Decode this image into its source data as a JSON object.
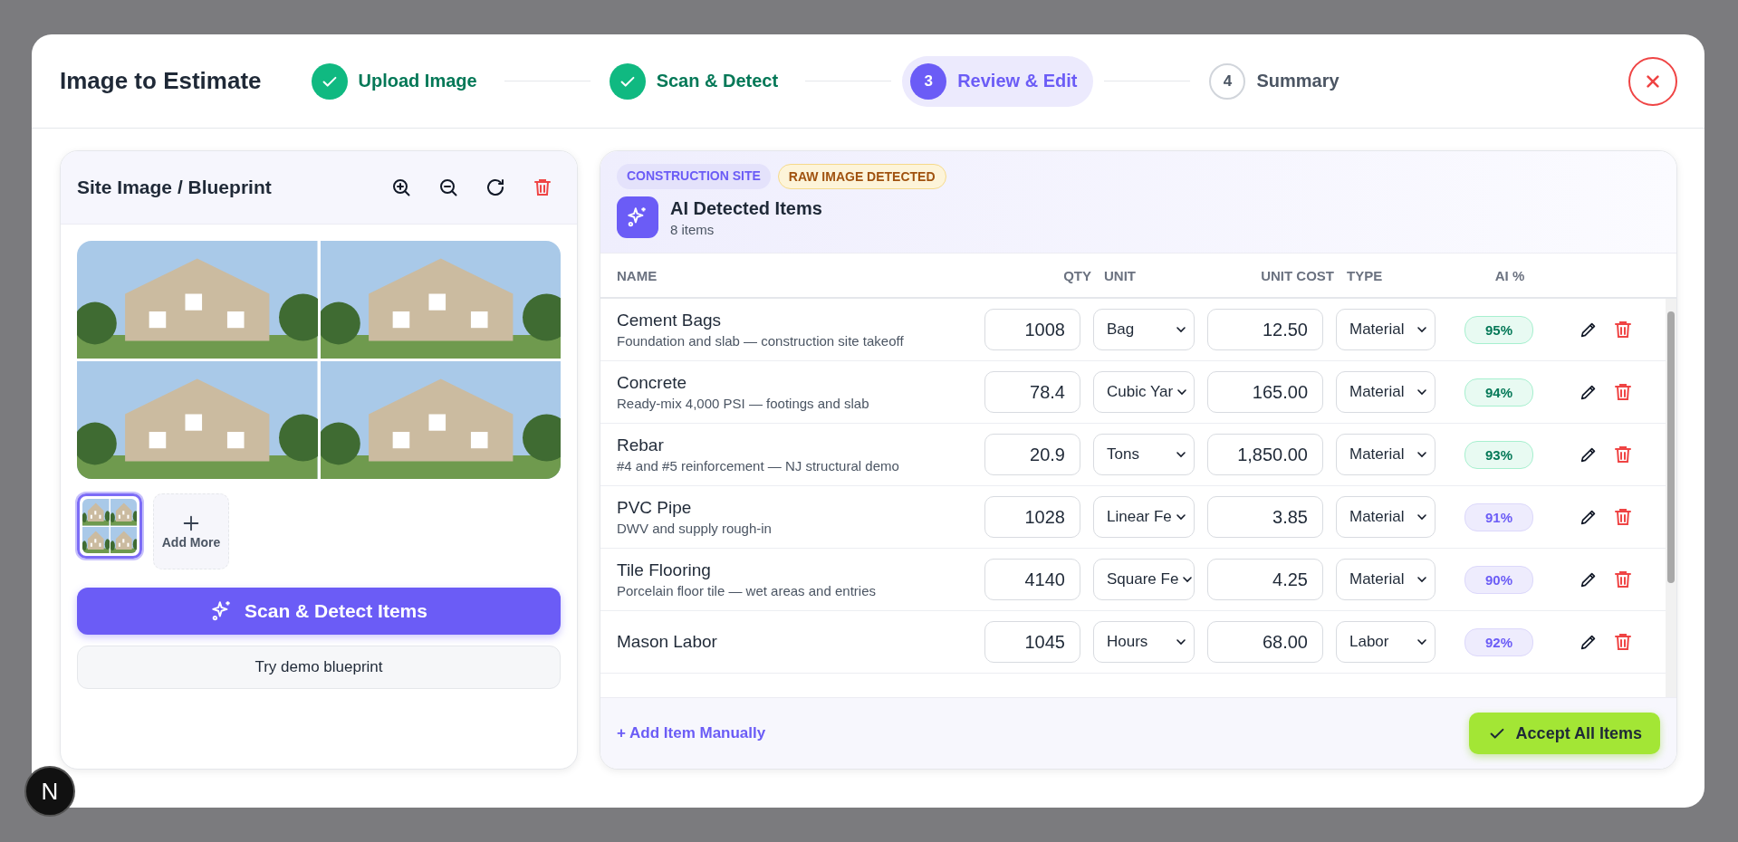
{
  "dialog": {
    "title": "Image to Estimate"
  },
  "steps": [
    {
      "label": "Upload Image",
      "completed": true,
      "selected": false
    },
    {
      "label": "Scan & Detect",
      "completed": true,
      "selected": false
    },
    {
      "number": "3",
      "label": "Review & Edit",
      "completed": false,
      "selected": true
    },
    {
      "number": "4",
      "label": "Summary",
      "completed": false,
      "selected": false
    }
  ],
  "image_panel": {
    "title": "Site Image / Blueprint",
    "thumbnails": [
      {
        "selected": true
      }
    ],
    "add_more": "Add More",
    "scan_button": "Scan & Detect Items",
    "demo_button": "Try demo blueprint"
  },
  "items_panel": {
    "tags": [
      {
        "label": "CONSTRUCTION SITE",
        "color": "#e4e2fb"
      },
      {
        "label": "RAW IMAGE DETECTED",
        "color": "#fdf4d9"
      }
    ],
    "title": "AI Detected Items",
    "count": "8 items",
    "columns": [
      "NAME",
      "QTY",
      "UNIT",
      "UNIT COST",
      "TYPE",
      "AI %"
    ],
    "rows": [
      {
        "name": "Cement Bags",
        "description": "Foundation and slab — construction site takeoff",
        "qty": "1008",
        "unit": "Bag",
        "unit_cost": "12.50",
        "type": "Material",
        "confidence": "95%",
        "color": "#e8faf2"
      },
      {
        "name": "Concrete",
        "description": "Ready-mix 4,000 PSI — footings and slab",
        "qty": "78.4",
        "unit": "Cubic Yar",
        "unit_cost": "165.00",
        "type": "Material",
        "confidence": "94%",
        "color": "#e8faf2"
      },
      {
        "name": "Rebar",
        "description": "#4 and #5 reinforcement — NJ structural demo",
        "qty": "20.9",
        "unit": "Tons",
        "unit_cost": "1,850.00",
        "type": "Material",
        "confidence": "93%",
        "color": "#e8faf2"
      },
      {
        "name": "PVC Pipe",
        "description": "DWV and supply rough-in",
        "qty": "1028",
        "unit": "Linear Fe",
        "unit_cost": "3.85",
        "type": "Material",
        "confidence": "91%",
        "color": "#eeecfd"
      },
      {
        "name": "Tile Flooring",
        "description": "Porcelain floor tile — wet areas and entries",
        "qty": "4140",
        "unit": "Square Fe",
        "unit_cost": "4.25",
        "type": "Material",
        "confidence": "90%",
        "color": "#eeecfd"
      },
      {
        "name": "Mason Labor",
        "qty": "1045",
        "unit": "Hours",
        "unit_cost": "68.00",
        "type": "Labor",
        "confidence": "92%",
        "color": "#eeecfd"
      }
    ],
    "add_manual": "+ Add Item Manually",
    "accept_button": "Accept All Items"
  },
  "dev_badge": "N"
}
